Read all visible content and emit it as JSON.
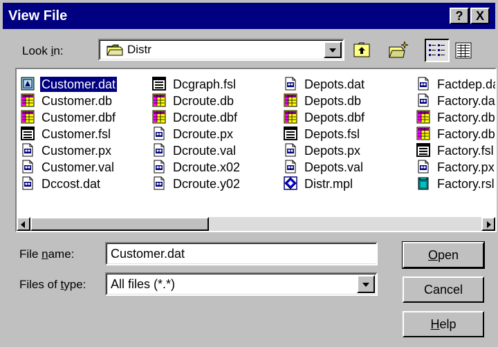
{
  "window": {
    "title": "View File",
    "help_button": "?",
    "close_button": "X"
  },
  "lookin": {
    "label_pre": "Look ",
    "label_key": "i",
    "label_post": "n:",
    "value": "Distr"
  },
  "toolbar": {
    "up_folder": "up-one-level",
    "new_folder": "create-new-folder",
    "list_view": "list",
    "details_view": "details"
  },
  "files": {
    "columns": [
      [
        {
          "name": "Customer.dat",
          "icon": "data-file",
          "selected": true
        },
        {
          "name": "Customer.db",
          "icon": "table-file"
        },
        {
          "name": "Customer.dbf",
          "icon": "table-file"
        },
        {
          "name": "Customer.fsl",
          "icon": "form-file"
        },
        {
          "name": "Customer.px",
          "icon": "generic-file"
        },
        {
          "name": "Customer.val",
          "icon": "generic-file"
        },
        {
          "name": "Dccost.dat",
          "icon": "generic-file"
        }
      ],
      [
        {
          "name": "Dcgraph.fsl",
          "icon": "form-file"
        },
        {
          "name": "Dcroute.db",
          "icon": "table-file"
        },
        {
          "name": "Dcroute.dbf",
          "icon": "table-file"
        },
        {
          "name": "Dcroute.px",
          "icon": "generic-file"
        },
        {
          "name": "Dcroute.val",
          "icon": "generic-file"
        },
        {
          "name": "Dcroute.x02",
          "icon": "generic-file"
        },
        {
          "name": "Dcroute.y02",
          "icon": "generic-file"
        }
      ],
      [
        {
          "name": "Depots.dat",
          "icon": "generic-file"
        },
        {
          "name": "Depots.db",
          "icon": "table-file"
        },
        {
          "name": "Depots.dbf",
          "icon": "table-file"
        },
        {
          "name": "Depots.fsl",
          "icon": "form-file"
        },
        {
          "name": "Depots.px",
          "icon": "generic-file"
        },
        {
          "name": "Depots.val",
          "icon": "generic-file"
        },
        {
          "name": "Distr.mpl",
          "icon": "map-file"
        }
      ],
      [
        {
          "name": "Factdep.dа",
          "icon": "generic-file"
        },
        {
          "name": "Factory.da",
          "icon": "generic-file"
        },
        {
          "name": "Factory.db",
          "icon": "table-file"
        },
        {
          "name": "Factory.db",
          "icon": "table-file"
        },
        {
          "name": "Factory.fsl",
          "icon": "form-file"
        },
        {
          "name": "Factory.px",
          "icon": "generic-file"
        },
        {
          "name": "Factory.rsl",
          "icon": "report-file"
        }
      ]
    ]
  },
  "filename": {
    "label_pre": "File ",
    "label_key": "n",
    "label_post": "ame:",
    "value": "Customer.dat"
  },
  "filetype": {
    "label_pre": "Files of ",
    "label_key": "t",
    "label_post": "ype:",
    "value": "All files (*.*)"
  },
  "buttons": {
    "open_key": "O",
    "open_rest": "pen",
    "cancel": "Cancel",
    "help_key": "H",
    "help_rest": "elp"
  },
  "colors": {
    "titlebar": "#000080",
    "face": "#c0c0c0",
    "selection": "#000080"
  }
}
